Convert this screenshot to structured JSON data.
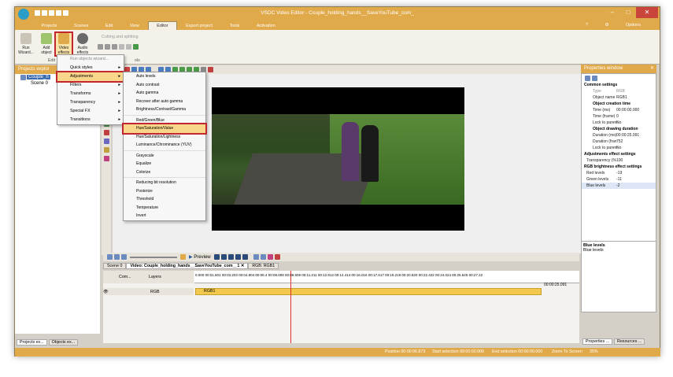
{
  "window": {
    "title": "VSDC Video Editor - Couple_holding_hands__SaveYouTube_com_",
    "options": "Options"
  },
  "menu": [
    "Projects",
    "Scenes",
    "Edit",
    "View",
    "Editor",
    "Export project",
    "Tools",
    "Activation"
  ],
  "ribbon": {
    "buttons": [
      {
        "label": "Run Wizard..."
      },
      {
        "label": "Add object"
      },
      {
        "label": "Video effects"
      },
      {
        "label": "Audio effects"
      }
    ],
    "group_edit": "Edit",
    "group_tools": "ols",
    "cutting": "Cutting and splitting"
  },
  "left_panel": {
    "title": "Projects explor",
    "tree": [
      "Couple_h",
      "Scene 0"
    ],
    "tabs": [
      "Projects ex...",
      "Objects ex..."
    ]
  },
  "menu1": {
    "items": [
      "Run objects wizard...",
      "Quick styles",
      "Adjustments",
      "Filters",
      "Transforms",
      "Transparency",
      "Special FX",
      "Transitions"
    ]
  },
  "menu2": {
    "items": [
      "Auto levels",
      "Auto contrast",
      "Auto gamma",
      "Recover after auto gamma",
      "Brightness/Contrast/Gamma",
      "Red/Green/Blue",
      "Hue/Saturation/Value",
      "Hue/Saturation/Lightness",
      "Luminance/Chrominance (YUV)",
      "Grayscale",
      "Equalize",
      "Colorize",
      "Reducing bit resolution",
      "Posterize",
      "Threshold",
      "Temperature",
      "Invert"
    ]
  },
  "properties": {
    "title": "Properties window",
    "common": "Common settings",
    "type_k": "Type",
    "type_v": "RGB",
    "name_k": "Object name",
    "name_v": "RGB1",
    "creation": "Object creation time",
    "time_ms_k": "Time (ms)",
    "time_ms_v": "00:00:00.000",
    "time_fr_k": "Time (frame)",
    "time_fr_v": "0",
    "lock_k": "Lock to parent",
    "lock_v": "No",
    "duration": "Object drawing duration",
    "dur_ms_k": "Duration (ms)",
    "dur_ms_v": "00:00:25.091",
    "dur_fr_k": "Duration (fran",
    "dur_fr_v": "752",
    "lock2_k": "Lock to parent",
    "lock2_v": "No",
    "adj": "Adjustments effect settings",
    "transp_k": "Transparency (%",
    "transp_v": "100",
    "rgb": "RGB brightness effect settings",
    "red_k": "Red levels",
    "red_v": "-19",
    "green_k": "Green levels",
    "green_v": "-11",
    "blue_k": "Blue levels",
    "blue_v": "-2",
    "help_title": "Blue levels",
    "help_text": "Blue levels",
    "tabs": [
      "Properties ...",
      "Resources ..."
    ]
  },
  "timeline": {
    "preview": "Preview",
    "tabs": [
      "Scene 0",
      "Video: Couple_holding_hands__SaveYouTube_com__1",
      "RGB: RGB1"
    ],
    "col_com": "Com...",
    "col_layers": "Layers",
    "track": "RGB",
    "clip": "RGB1",
    "ruler": [
      "0.000",
      "00:01.601",
      "00:03.203",
      "00:04.804",
      "00:06.4",
      "00:08.008",
      "00:09.609",
      "00:11.211",
      "00:12.812",
      "00:14.414",
      "00:16.016",
      "00:17.617",
      "00:19.219",
      "00:20.820",
      "00:22.422",
      "00:24.024",
      "00:25.625",
      "00:27.22"
    ],
    "end_time": "00:00:25.091"
  },
  "status": {
    "position": "Position",
    "position_v": "00:00:06.873",
    "start": "Start selection",
    "start_v": "00:00:00.000",
    "end": "End selection",
    "end_v": "00:00:00.000",
    "zoom": "Zoom To Screen",
    "zoom_v": "35%"
  }
}
